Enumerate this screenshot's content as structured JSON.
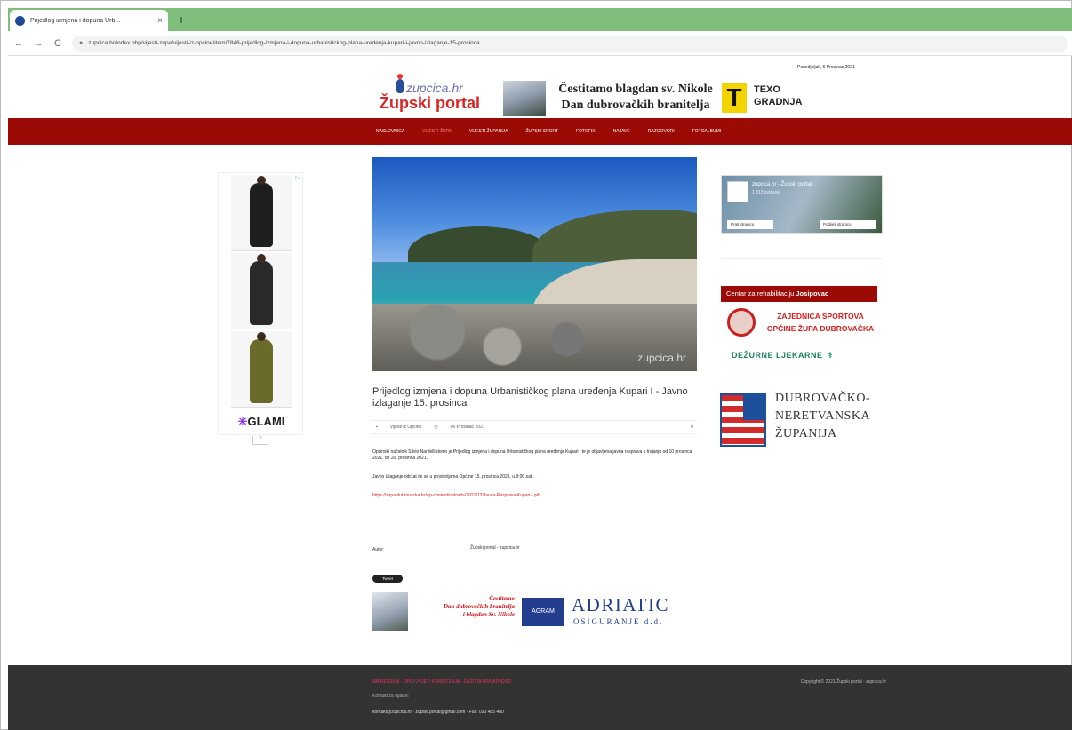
{
  "browser": {
    "tab_title": "Prijedlog izmjena i dopuna Urb...",
    "tab_close": "×",
    "new_tab": "+",
    "back": "←",
    "forward": "→",
    "reload": "C",
    "url": "zupcica.hr/index.php/vijesti-zupa/vijesti-iz-opcine/item/7846-prijedlog-izmjena-i-dopuna-urbanistickog-plana-uredenja-kupari-i-javno-izlaganje-15-prosinca"
  },
  "site": {
    "date": "Ponedjeljak, 6 Prosinac 2021",
    "logo_top": "zupcica.hr",
    "logo_main": "Župski portal",
    "header_banner": {
      "line1": "Čestitamo blagdan sv. Nikole",
      "line2": "Dan dubrovačkih branitelja",
      "t_letter": "T",
      "texo1": "TEXO",
      "texo2": "GRADNJA"
    },
    "nav": [
      "NASLOVNICA",
      "VIJESTI ŽUPA",
      "VIJESTI ŽUPANIJA",
      "ŽUPSKI SPORT",
      "FOTOFIX",
      "NAJAVE",
      "RAZGOVORI",
      "FOTOALBUMI"
    ]
  },
  "left_ad": {
    "adchoices": "▷",
    "brand_star": "✳",
    "brand": "GLAMI",
    "collapse": "^"
  },
  "article": {
    "watermark": "zupcica.hr",
    "title": "Prijedlog izmjena i dopuna Urbanističkog plana uređenja Kupari I - Javno izlaganje 15. prosinca",
    "category": "Vijesti iz Općine",
    "date": "06 Prosinac 2021",
    "comments": "0",
    "para1": "Općinski načelnik Silvio Nardelli donio je Prijedlog izmjena i dopuna Urbanističkog plana uređenja Kupari I te je objavljena javna rasprava u trajanju od 10 prosinca 2021. do 20. prosinca 2021.",
    "para2": "Javno izlaganje održat će se u prostorijama Općine 15. prosinca 2021. u 9:00 sati.",
    "link": "https://zupa-dubrovacka.hr/wp-content/uploads/2021/12/Javna-Rasprava-Kupari-I.pdf",
    "author_label": "Autor:",
    "author": "Župski portal - zupcica.hr",
    "tweet": "Tweet"
  },
  "bottom_banner": {
    "red_line1": "Čestitamo",
    "red_line2": "Dan dubrovačkih branitelja",
    "red_line3": "i blagdan Sv. Nikole",
    "agram": "AGRAM",
    "adriatic": "ADRIATIC",
    "osiguranje": "OSIGURANJE d.d."
  },
  "sidebar": {
    "fb_name": "zupcica.hr - Župski portal",
    "fb_sub": "1.813 sviđanja",
    "fb_like": "Prati stranicu",
    "fb_share": "Podijeli stranicu",
    "cr_text": "Centar za rehabilitaciju",
    "cr_bold": "Josipovac",
    "zs1": "ZAJEDNICA SPORTOVA",
    "zs2": "OPĆINE ŽUPA DUBROVAČKA",
    "dezurne": "DEŽURNE LJEKARNE",
    "dezurne_icon": "⚕",
    "dnz1": "DUBROVAČKO-",
    "dnz2": "NERETVANSKA",
    "dnz3": "ŽUPANIJA"
  },
  "footer": {
    "line1": "IMPRESSUM · OPĆI UVJETI KORIŠTENJA · ZAŠTITA PRIVATNOSTI",
    "line2": "Kontakt za oglase:",
    "line3": "kontakt@zupcica.hr · zupski.portal@gmail.com · Fax: 020 485 480",
    "copy": "Copyright © 2021 Župski portal - zupcica.hr"
  }
}
